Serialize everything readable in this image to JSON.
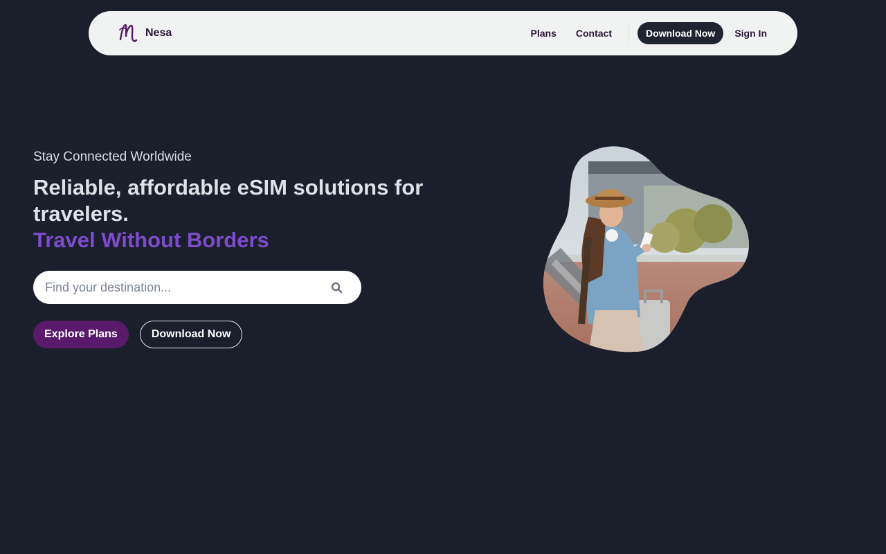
{
  "nav": {
    "brand": "Nesa",
    "links": [
      {
        "label": "Plans"
      },
      {
        "label": "Contact"
      }
    ],
    "cta_label": "Download Now",
    "signin_label": "Sign In"
  },
  "hero": {
    "eyebrow": "Stay Connected Worldwide",
    "headline": "Reliable, affordable eSIM solutions for travelers.",
    "accent": "Travel Without Borders"
  },
  "search": {
    "placeholder": "Find your destination...",
    "value": "",
    "icon": "search-icon"
  },
  "actions": {
    "primary_label": "Explore Plans",
    "secondary_label": "Download Now"
  },
  "image": {
    "icon": "hero-photo-traveler-with-phone"
  },
  "colors": {
    "background": "#1b1f2b",
    "nav_bg": "#f1f3f2",
    "accent": "#7c4ccc",
    "primary_button": "#5a1a6b",
    "nav_cta": "#1f2430"
  }
}
